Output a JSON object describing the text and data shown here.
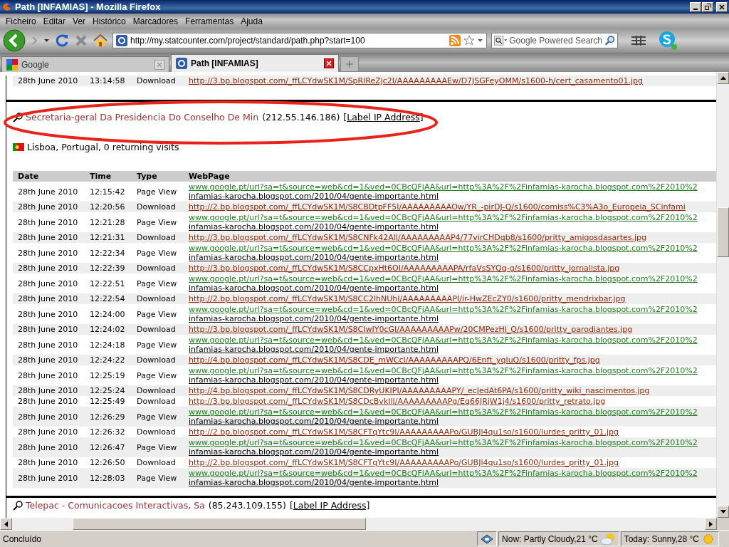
{
  "window": {
    "title": "Path [INFAMIAS] - Mozilla Firefox"
  },
  "menu": [
    "Ficheiro",
    "Editar",
    "Ver",
    "Histórico",
    "Marcadores",
    "Ferramentas",
    "Ajuda"
  ],
  "toolbar": {
    "url": "http://my.statcounter.com/project/standard/path.php?start=100",
    "search_placeholder": "Google Powered Search"
  },
  "tabs": [
    {
      "label": "Google",
      "selected": false
    },
    {
      "label": "Path [INFAMIAS]",
      "selected": true
    }
  ],
  "previous_visit": {
    "kind": "download",
    "date": "28th June 2010",
    "time": "13:14:58",
    "type": "Download",
    "file": "http://3.bp.blogspot.com/_ffLCYdwSK1M/SpRlReZjc2I/AAAAAAAAAEw/D7JSGFeyOMM/s1600-h/cert_casamento01.jpg"
  },
  "visitor": {
    "name": "Secretaria-geral Da Presidencia Do Conselho De Min",
    "ip": "(212.55.146.186)",
    "label_link": "[Label IP Address]",
    "location": "Lisboa, Portugal, 0 returning visits"
  },
  "table": {
    "columns": [
      "Date",
      "Time",
      "Type",
      "WebPage"
    ],
    "rows": [
      {
        "kind": "page_view",
        "date": "28th June 2010",
        "time": "12:15:42",
        "type": "Page View",
        "referrer": "www.google.pt/url?sa=t&source=web&cd=1&ved=0CBcQFjAA&url=http%3A%2F%2Finfamias-karocha.blogspot.com%2F2010%2",
        "page": "infamias-karocha.blogspot.com/2010/04/gente-importante.html"
      },
      {
        "kind": "download",
        "date": "28th June 2010",
        "time": "12:20:56",
        "type": "Download",
        "file": "http://2.bp.blogspot.com/_ffLCYdwSK1M/S8CBDtpFF5I/AAAAAAAAAOw/YR_-pirDJ-Q/s1600/comiss%C3%A3o_Europeia_SCinfami"
      },
      {
        "kind": "page_view",
        "date": "28th June 2010",
        "time": "12:21:28",
        "type": "Page View",
        "referrer": "www.google.pt/url?sa=t&source=web&cd=1&ved=0CBcQFjAA&url=http%3A%2F%2Finfamias-karocha.blogspot.com%2F2010%2",
        "page": "infamias-karocha.blogspot.com/2010/04/gente-importante.html"
      },
      {
        "kind": "download",
        "date": "28th June 2010",
        "time": "12:21:31",
        "type": "Download",
        "file": "http://3.bp.blogspot.com/_ffLCYdwSK1M/S8CNFk42AlI/AAAAAAAAAP4/77virCHDqb8/s1600/pritty_amigosdasartes.jpg"
      },
      {
        "kind": "page_view",
        "date": "28th June 2010",
        "time": "12:22:34",
        "type": "Page View",
        "referrer": "www.google.pt/url?sa=t&source=web&cd=1&ved=0CBcQFjAA&url=http%3A%2F%2Finfamias-karocha.blogspot.com%2F2010%2",
        "page": "infamias-karocha.blogspot.com/2010/04/gente-importante.html"
      },
      {
        "kind": "download",
        "date": "28th June 2010",
        "time": "12:22:39",
        "type": "Download",
        "file": "http://3.bp.blogspot.com/_ffLCYdwSK1M/S8CCpxHt6OI/AAAAAAAAAPA/rfaVsSYQq-g/s1600/pritty_jornalista.jpg"
      },
      {
        "kind": "page_view",
        "date": "28th June 2010",
        "time": "12:22:51",
        "type": "Page View",
        "referrer": "www.google.pt/url?sa=t&source=web&cd=1&ved=0CBcQFjAA&url=http%3A%2F%2Finfamias-karocha.blogspot.com%2F2010%2",
        "page": "infamias-karocha.blogspot.com/2010/04/gente-importante.html"
      },
      {
        "kind": "download",
        "date": "28th June 2010",
        "time": "12:22:54",
        "type": "Download",
        "file": "http://2.bp.blogspot.com/_ffLCYdwSK1M/S8CC2lhNUhI/AAAAAAAAAPI/ir-HwZEcZY0/s1600/pritty_mendrixbar.jpg"
      },
      {
        "kind": "page_view",
        "date": "28th June 2010",
        "time": "12:24:00",
        "type": "Page View",
        "referrer": "www.google.pt/url?sa=t&source=web&cd=1&ved=0CBcQFjAA&url=http%3A%2F%2Finfamias-karocha.blogspot.com%2F2010%2",
        "page": "infamias-karocha.blogspot.com/2010/04/gente-importante.html"
      },
      {
        "kind": "download",
        "date": "28th June 2010",
        "time": "12:24:02",
        "type": "Download",
        "file": "http://3.bp.blogspot.com/_ffLCYdwSK1M/S8CIwIY0cGI/AAAAAAAAAPw/20CMPezHl_Q/s1600/pritty_parodiantes.jpg"
      },
      {
        "kind": "page_view",
        "date": "28th June 2010",
        "time": "12:24:18",
        "type": "Page View",
        "referrer": "www.google.pt/url?sa=t&source=web&cd=1&ved=0CBcQFjAA&url=http%3A%2F%2Finfamias-karocha.blogspot.com%2F2010%2",
        "page": "infamias-karocha.blogspot.com/2010/04/gente-importante.html"
      },
      {
        "kind": "download",
        "date": "28th June 2010",
        "time": "12:24:22",
        "type": "Download",
        "file": "http://4.bp.blogspot.com/_ffLCYdwSK1M/S8CDE_mWCcI/AAAAAAAAAPQ/6Enft_yqluQ/s1600/pritty_fps.jpg"
      },
      {
        "kind": "page_view",
        "date": "28th June 2010",
        "time": "12:25:19",
        "type": "Page View",
        "referrer": "www.google.pt/url?sa=t&source=web&cd=1&ved=0CBcQFjAA&url=http%3A%2F%2Finfamias-karocha.blogspot.com%2F2010%2",
        "page": "infamias-karocha.blogspot.com/2010/04/gente-importante.html"
      },
      {
        "kind": "download",
        "date": "28th June 2010",
        "time": "12:25:24",
        "type": "Download",
        "file": "http://4.bp.blogspot.com/_ffLCYdwSK1M/S8CDRyUKIPI/AAAAAAAAAPY/_ecJedAt6PA/s1600/pritty_wiki_nascimentos.jpg"
      },
      {
        "kind": "download",
        "date": "28th June 2010",
        "time": "12:25:49",
        "type": "Download",
        "file": "http://3.bp.blogspot.com/_ffLCYdwSK1M/S8CDcBvkIlI/AAAAAAAAAPg/Eq66JRjW1j4/s1600/pritty_retrato.jpg"
      },
      {
        "kind": "page_view",
        "date": "28th June 2010",
        "time": "12:26:29",
        "type": "Page View",
        "referrer": "www.google.pt/url?sa=t&source=web&cd=1&ved=0CBcQFjAA&url=http%3A%2F%2Finfamias-karocha.blogspot.com%2F2010%2",
        "page": "infamias-karocha.blogspot.com/2010/04/gente-importante.html"
      },
      {
        "kind": "download",
        "date": "28th June 2010",
        "time": "12:26:32",
        "type": "Download",
        "file": "http://2.bp.blogspot.com/_ffLCYdwSK1M/S8CFTqYtc9I/AAAAAAAAAPo/GUBJl4qu1so/s1600/lurdes_pritty_01.jpg"
      },
      {
        "kind": "page_view",
        "date": "28th June 2010",
        "time": "12:26:47",
        "type": "Page View",
        "referrer": "www.google.pt/url?sa=t&source=web&cd=1&ved=0CBcQFjAA&url=http%3A%2F%2Finfamias-karocha.blogspot.com%2F2010%2",
        "page": "infamias-karocha.blogspot.com/2010/04/gente-importante.html"
      },
      {
        "kind": "download",
        "date": "28th June 2010",
        "time": "12:26:50",
        "type": "Download",
        "file": "http://2.bp.blogspot.com/_ffLCYdwSK1M/S8CFTqYtc9I/AAAAAAAAAPo/GUBJl4qu1so/s1600/lurdes_pritty_01.jpg"
      },
      {
        "kind": "page_view",
        "date": "28th June 2010",
        "time": "12:28:03",
        "type": "Page View",
        "referrer": "www.google.pt/url?sa=t&source=web&cd=1&ved=0CBcQFjAA&url=http%3A%2F%2Finfamias-karocha.blogspot.com%2F2010%2",
        "page": "infamias-karocha.blogspot.com/2010/04/gente-importante.html"
      }
    ]
  },
  "next_visitor": {
    "name": "Telepac - Comunicacoes Interactivas, Sa",
    "ip": "(85.243.109.155)",
    "label_link": "[Label IP Address]"
  },
  "status_bar": {
    "text": "Concluído",
    "weather_now": "Now: Partly Cloudy,21 °C",
    "weather_today": "Today: Sunny,28 °C"
  }
}
